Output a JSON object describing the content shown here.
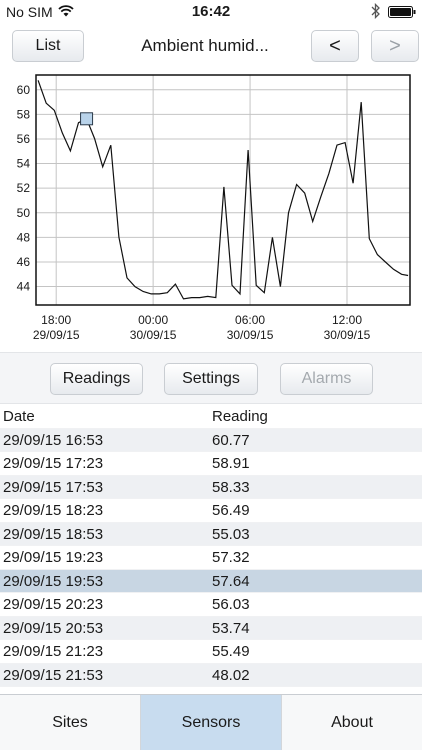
{
  "status": {
    "carrier": "No SIM",
    "time": "16:42"
  },
  "nav": {
    "list_label": "List",
    "title": "Ambient humid...",
    "prev_label": "<",
    "next_label": ">"
  },
  "chart_data": {
    "type": "line",
    "title": "",
    "xlabel": "",
    "ylabel": "",
    "x_ticks": [
      {
        "time": "18:00",
        "date": "29/09/15",
        "hours": 18
      },
      {
        "time": "00:00",
        "date": "30/09/15",
        "hours": 24
      },
      {
        "time": "06:00",
        "date": "30/09/15",
        "hours": 30
      },
      {
        "time": "12:00",
        "date": "30/09/15",
        "hours": 36
      }
    ],
    "y_ticks": [
      44,
      46,
      48,
      50,
      52,
      54,
      56,
      58,
      60
    ],
    "ylim": [
      42.5,
      61.2
    ],
    "xlim": [
      16.75,
      39.9
    ],
    "grid": true,
    "selected_index": 6,
    "x_hours": [
      16.88,
      17.38,
      17.88,
      18.38,
      18.88,
      19.38,
      19.88,
      20.38,
      20.88,
      21.38,
      21.88,
      22.38,
      22.88,
      23.38,
      23.88,
      24.38,
      24.88,
      25.38,
      25.88,
      26.38,
      26.88,
      27.38,
      27.88,
      28.38,
      28.88,
      29.38,
      29.88,
      30.38,
      30.88,
      31.38,
      31.88,
      32.38,
      32.88,
      33.38,
      33.88,
      34.38,
      34.88,
      35.38,
      35.88,
      36.38,
      36.88,
      37.38,
      37.88,
      38.38,
      38.88,
      39.38,
      39.78
    ],
    "values": [
      60.77,
      58.91,
      58.33,
      56.49,
      55.03,
      57.32,
      57.64,
      56.03,
      53.74,
      55.49,
      48.02,
      44.7,
      44.0,
      43.6,
      43.4,
      43.4,
      43.5,
      44.2,
      43.0,
      43.1,
      43.1,
      43.2,
      43.1,
      52.1,
      44.1,
      43.4,
      55.1,
      44.1,
      43.5,
      48.0,
      44.0,
      50.0,
      52.3,
      51.6,
      49.3,
      51.3,
      53.2,
      55.5,
      55.7,
      52.4,
      59.0,
      47.9,
      46.6,
      46.0,
      45.4,
      45.0,
      44.9
    ]
  },
  "tabs_mid": {
    "readings": "Readings",
    "settings": "Settings",
    "alarms": "Alarms"
  },
  "table": {
    "headers": {
      "date": "Date",
      "reading": "Reading"
    },
    "rows": [
      {
        "date": "29/09/15 16:53",
        "reading": "60.77"
      },
      {
        "date": "29/09/15 17:23",
        "reading": "58.91"
      },
      {
        "date": "29/09/15 17:53",
        "reading": "58.33"
      },
      {
        "date": "29/09/15 18:23",
        "reading": "56.49"
      },
      {
        "date": "29/09/15 18:53",
        "reading": "55.03"
      },
      {
        "date": "29/09/15 19:23",
        "reading": "57.32"
      },
      {
        "date": "29/09/15 19:53",
        "reading": "57.64"
      },
      {
        "date": "29/09/15 20:23",
        "reading": "56.03"
      },
      {
        "date": "29/09/15 20:53",
        "reading": "53.74"
      },
      {
        "date": "29/09/15 21:23",
        "reading": "55.49"
      },
      {
        "date": "29/09/15 21:53",
        "reading": "48.02"
      }
    ],
    "selected_row": 6
  },
  "bottom_tabs": {
    "sites": "Sites",
    "sensors": "Sensors",
    "about": "About"
  },
  "colors": {
    "selected_row": "#c8d6e3",
    "active_tab": "#c8dcef",
    "marker": "#b9d3ea"
  }
}
